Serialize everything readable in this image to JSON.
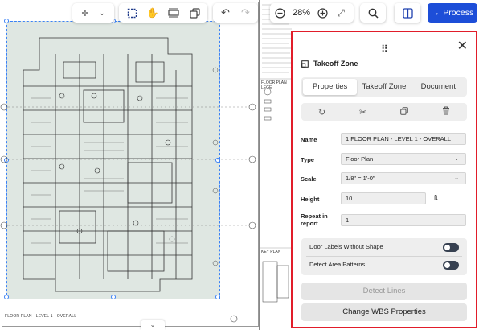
{
  "canvas": {
    "plan_title": "FLOOR PLAN - LEVEL 1 - OVERALL",
    "legend_floor_plan": "FLOOR PLAN LEGE",
    "legend_key_plan": "KEY PLAN"
  },
  "toolbar": {
    "zoom_level": "28%",
    "process_label": "Process",
    "icons": [
      "crosshair-icon",
      "chevron-down-icon",
      "select-icon",
      "hand-icon",
      "measure-icon",
      "copy-icon",
      "undo-icon",
      "redo-icon",
      "zoom-out-icon",
      "zoom-in-icon",
      "fullscreen-icon",
      "search-icon",
      "sidebar-icon",
      "arrow-right-icon"
    ]
  },
  "panel": {
    "title": "Takeoff Zone",
    "tabs": [
      {
        "label": "Properties",
        "active": true
      },
      {
        "label": "Takeoff Zone",
        "active": false
      },
      {
        "label": "Document",
        "active": false
      }
    ],
    "fields": {
      "name_label": "Name",
      "name_value": "1 FLOOR PLAN - LEVEL 1 - OVERALL",
      "type_label": "Type",
      "type_value": "Floor Plan",
      "scale_label": "Scale",
      "scale_value": "1/8\" = 1'-0\"",
      "height_label": "Height",
      "height_value": "10",
      "height_unit": "ft",
      "repeat_label_line1": "Repeat in",
      "repeat_label_line2": "report",
      "repeat_value": "1"
    },
    "toggles": [
      {
        "label": "Door Labels Without Shape",
        "on": false
      },
      {
        "label": "Detect Area Patterns",
        "on": false
      }
    ],
    "detect_lines_label": "Detect Lines",
    "wbs_label": "Change WBS Properties"
  },
  "colors": {
    "accent": "#1d4ed8",
    "highlight_border": "#e11d2a",
    "selection": "#3b82f6"
  }
}
